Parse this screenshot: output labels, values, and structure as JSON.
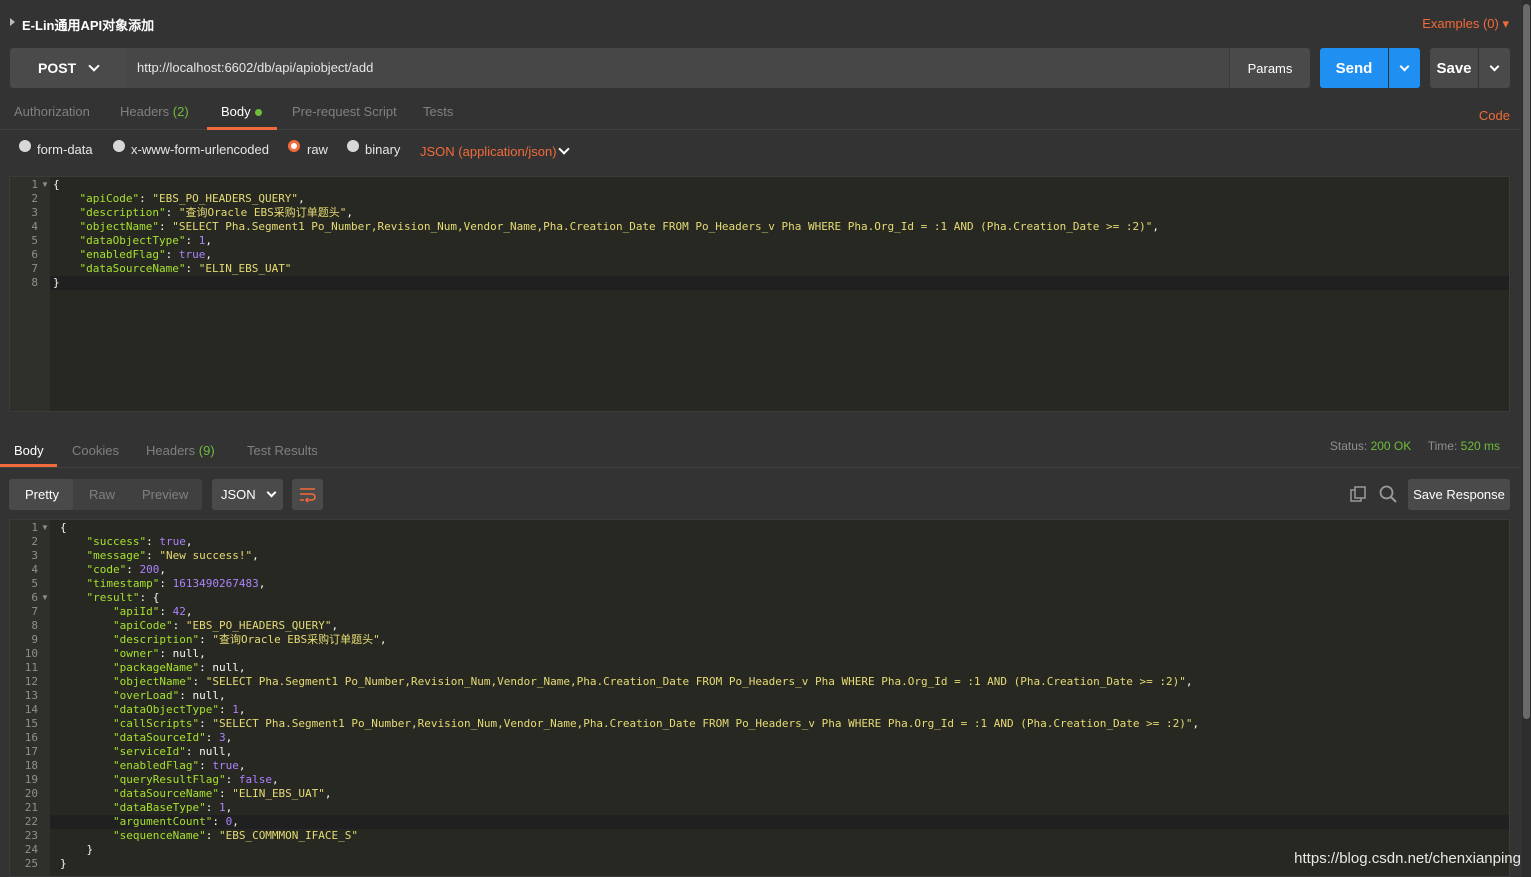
{
  "title": "E-Lin通用API对象添加",
  "examples": "Examples (0)",
  "request": {
    "method": "POST",
    "url": "http://localhost:6602/db/api/apiobject/add",
    "params_label": "Params",
    "send_label": "Send",
    "save_label": "Save"
  },
  "req_tabs": {
    "authorization": "Authorization",
    "headers": "Headers",
    "headers_count": "(2)",
    "body": "Body",
    "prerequest": "Pre-request Script",
    "tests": "Tests",
    "code": "Code"
  },
  "body_types": {
    "form_data": "form-data",
    "urlencoded": "x-www-form-urlencoded",
    "raw": "raw",
    "binary": "binary",
    "selected_type": "JSON (application/json)"
  },
  "request_body": [
    {
      "ln": "1",
      "fold": true,
      "tokens": [
        [
          "p",
          "{"
        ]
      ]
    },
    {
      "ln": "2",
      "tokens": [
        [
          "p",
          "    "
        ],
        [
          "k",
          "\"apiCode\""
        ],
        [
          "p",
          ": "
        ],
        [
          "s",
          "\"EBS_PO_HEADERS_QUERY\""
        ],
        [
          "p",
          ","
        ]
      ]
    },
    {
      "ln": "3",
      "tokens": [
        [
          "p",
          "    "
        ],
        [
          "k",
          "\"description\""
        ],
        [
          "p",
          ": "
        ],
        [
          "s",
          "\"查询Oracle EBS采购订单题头\""
        ],
        [
          "p",
          ","
        ]
      ]
    },
    {
      "ln": "4",
      "tokens": [
        [
          "p",
          "    "
        ],
        [
          "k",
          "\"objectName\""
        ],
        [
          "p",
          ": "
        ],
        [
          "s",
          "\"SELECT Pha.Segment1 Po_Number,Revision_Num,Vendor_Name,Pha.Creation_Date FROM Po_Headers_v Pha WHERE Pha.Org_Id = :1 AND (Pha.Creation_Date >= :2)\""
        ],
        [
          "p",
          ","
        ]
      ]
    },
    {
      "ln": "5",
      "tokens": [
        [
          "p",
          "    "
        ],
        [
          "k",
          "\"dataObjectType\""
        ],
        [
          "p",
          ": "
        ],
        [
          "n",
          "1"
        ],
        [
          "p",
          ","
        ]
      ]
    },
    {
      "ln": "6",
      "tokens": [
        [
          "p",
          "    "
        ],
        [
          "k",
          "\"enabledFlag\""
        ],
        [
          "p",
          ": "
        ],
        [
          "n",
          "true"
        ],
        [
          "p",
          ","
        ]
      ]
    },
    {
      "ln": "7",
      "tokens": [
        [
          "p",
          "    "
        ],
        [
          "k",
          "\"dataSourceName\""
        ],
        [
          "p",
          ": "
        ],
        [
          "s",
          "\"ELIN_EBS_UAT\""
        ]
      ]
    },
    {
      "ln": "8",
      "highlight": true,
      "tokens": [
        [
          "p",
          "}"
        ]
      ]
    }
  ],
  "resp_tabs": {
    "body": "Body",
    "cookies": "Cookies",
    "headers": "Headers",
    "headers_count": "(9)",
    "test_results": "Test Results"
  },
  "status": {
    "status_label": "Status:",
    "status_value": "200 OK",
    "time_label": "Time:",
    "time_value": "520 ms"
  },
  "view": {
    "pretty": "Pretty",
    "raw": "Raw",
    "preview": "Preview",
    "format": "JSON",
    "save_response": "Save Response"
  },
  "response_body": [
    {
      "ln": "1",
      "fold": true,
      "tokens": [
        [
          "p",
          "{"
        ]
      ]
    },
    {
      "ln": "2",
      "tokens": [
        [
          "p",
          "    "
        ],
        [
          "k",
          "\"success\""
        ],
        [
          "p",
          ": "
        ],
        [
          "n",
          "true"
        ],
        [
          "p",
          ","
        ]
      ]
    },
    {
      "ln": "3",
      "tokens": [
        [
          "p",
          "    "
        ],
        [
          "k",
          "\"message\""
        ],
        [
          "p",
          ": "
        ],
        [
          "s",
          "\"New success!\""
        ],
        [
          "p",
          ","
        ]
      ]
    },
    {
      "ln": "4",
      "tokens": [
        [
          "p",
          "    "
        ],
        [
          "k",
          "\"code\""
        ],
        [
          "p",
          ": "
        ],
        [
          "n",
          "200"
        ],
        [
          "p",
          ","
        ]
      ]
    },
    {
      "ln": "5",
      "tokens": [
        [
          "p",
          "    "
        ],
        [
          "k",
          "\"timestamp\""
        ],
        [
          "p",
          ": "
        ],
        [
          "n",
          "1613490267483"
        ],
        [
          "p",
          ","
        ]
      ]
    },
    {
      "ln": "6",
      "fold": true,
      "tokens": [
        [
          "p",
          "    "
        ],
        [
          "k",
          "\"result\""
        ],
        [
          "p",
          ": {"
        ]
      ]
    },
    {
      "ln": "7",
      "tokens": [
        [
          "p",
          "        "
        ],
        [
          "k",
          "\"apiId\""
        ],
        [
          "p",
          ": "
        ],
        [
          "n",
          "42"
        ],
        [
          "p",
          ","
        ]
      ]
    },
    {
      "ln": "8",
      "tokens": [
        [
          "p",
          "        "
        ],
        [
          "k",
          "\"apiCode\""
        ],
        [
          "p",
          ": "
        ],
        [
          "s",
          "\"EBS_PO_HEADERS_QUERY\""
        ],
        [
          "p",
          ","
        ]
      ]
    },
    {
      "ln": "9",
      "tokens": [
        [
          "p",
          "        "
        ],
        [
          "k",
          "\"description\""
        ],
        [
          "p",
          ": "
        ],
        [
          "s",
          "\"查询Oracle EBS采购订单题头\""
        ],
        [
          "p",
          ","
        ]
      ]
    },
    {
      "ln": "10",
      "tokens": [
        [
          "p",
          "        "
        ],
        [
          "k",
          "\"owner\""
        ],
        [
          "p",
          ": null,"
        ]
      ]
    },
    {
      "ln": "11",
      "tokens": [
        [
          "p",
          "        "
        ],
        [
          "k",
          "\"packageName\""
        ],
        [
          "p",
          ": null,"
        ]
      ]
    },
    {
      "ln": "12",
      "tokens": [
        [
          "p",
          "        "
        ],
        [
          "k",
          "\"objectName\""
        ],
        [
          "p",
          ": "
        ],
        [
          "s",
          "\"SELECT Pha.Segment1 Po_Number,Revision_Num,Vendor_Name,Pha.Creation_Date FROM Po_Headers_v Pha WHERE Pha.Org_Id = :1 AND (Pha.Creation_Date >= :2)\""
        ],
        [
          "p",
          ","
        ]
      ]
    },
    {
      "ln": "13",
      "tokens": [
        [
          "p",
          "        "
        ],
        [
          "k",
          "\"overLoad\""
        ],
        [
          "p",
          ": null,"
        ]
      ]
    },
    {
      "ln": "14",
      "tokens": [
        [
          "p",
          "        "
        ],
        [
          "k",
          "\"dataObjectType\""
        ],
        [
          "p",
          ": "
        ],
        [
          "n",
          "1"
        ],
        [
          "p",
          ","
        ]
      ]
    },
    {
      "ln": "15",
      "tokens": [
        [
          "p",
          "        "
        ],
        [
          "k",
          "\"callScripts\""
        ],
        [
          "p",
          ": "
        ],
        [
          "s",
          "\"SELECT Pha.Segment1 Po_Number,Revision_Num,Vendor_Name,Pha.Creation_Date FROM Po_Headers_v Pha WHERE Pha.Org_Id = :1 AND (Pha.Creation_Date >= :2)\""
        ],
        [
          "p",
          ","
        ]
      ]
    },
    {
      "ln": "16",
      "tokens": [
        [
          "p",
          "        "
        ],
        [
          "k",
          "\"dataSourceId\""
        ],
        [
          "p",
          ": "
        ],
        [
          "n",
          "3"
        ],
        [
          "p",
          ","
        ]
      ]
    },
    {
      "ln": "17",
      "tokens": [
        [
          "p",
          "        "
        ],
        [
          "k",
          "\"serviceId\""
        ],
        [
          "p",
          ": null,"
        ]
      ]
    },
    {
      "ln": "18",
      "tokens": [
        [
          "p",
          "        "
        ],
        [
          "k",
          "\"enabledFlag\""
        ],
        [
          "p",
          ": "
        ],
        [
          "n",
          "true"
        ],
        [
          "p",
          ","
        ]
      ]
    },
    {
      "ln": "19",
      "tokens": [
        [
          "p",
          "        "
        ],
        [
          "k",
          "\"queryResultFlag\""
        ],
        [
          "p",
          ": "
        ],
        [
          "n",
          "false"
        ],
        [
          "p",
          ","
        ]
      ]
    },
    {
      "ln": "20",
      "tokens": [
        [
          "p",
          "        "
        ],
        [
          "k",
          "\"dataSourceName\""
        ],
        [
          "p",
          ": "
        ],
        [
          "s",
          "\"ELIN_EBS_UAT\""
        ],
        [
          "p",
          ","
        ]
      ]
    },
    {
      "ln": "21",
      "tokens": [
        [
          "p",
          "        "
        ],
        [
          "k",
          "\"dataBaseType\""
        ],
        [
          "p",
          ": "
        ],
        [
          "n",
          "1"
        ],
        [
          "p",
          ","
        ]
      ]
    },
    {
      "ln": "22",
      "highlight": true,
      "tokens": [
        [
          "p",
          "        "
        ],
        [
          "k",
          "\"argumentCount\""
        ],
        [
          "p",
          ": "
        ],
        [
          "n",
          "0"
        ],
        [
          "p",
          ","
        ]
      ]
    },
    {
      "ln": "23",
      "tokens": [
        [
          "p",
          "        "
        ],
        [
          "k",
          "\"sequenceName\""
        ],
        [
          "p",
          ": "
        ],
        [
          "s",
          "\"EBS_COMMMON_IFACE_S\""
        ]
      ]
    },
    {
      "ln": "24",
      "tokens": [
        [
          "p",
          "    }"
        ]
      ]
    },
    {
      "ln": "25",
      "tokens": [
        [
          "p",
          "}"
        ]
      ]
    }
  ],
  "watermark": "https://blog.csdn.net/chenxianping",
  "colors": {
    "accent": "#f26b3a",
    "send": "#1f8ff2",
    "status_ok": "#6fbd3c",
    "json_key": "#a6e22e",
    "json_string": "#e6db74",
    "json_number": "#ae81ff"
  }
}
